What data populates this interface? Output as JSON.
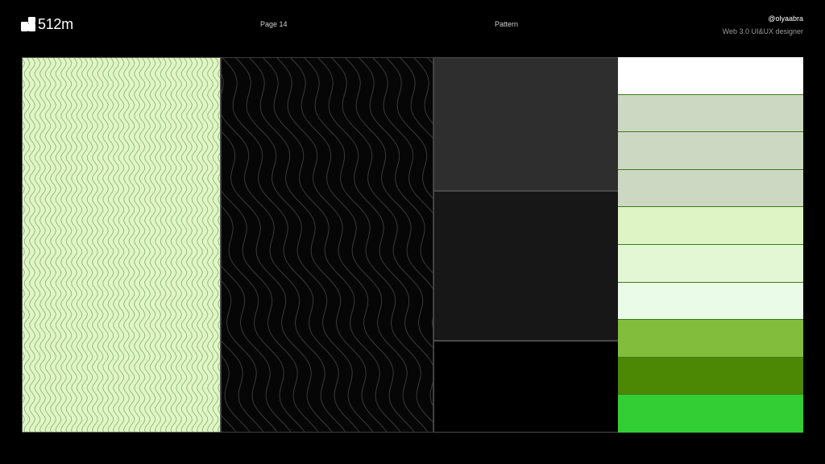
{
  "header": {
    "logo_text": "512m",
    "page_label": "Page 14",
    "section_label": "Pattern",
    "author_handle": "@olyaabra",
    "author_role": "Web 3.0 UI&UX designer"
  },
  "icons": {
    "logo": "stacked-squares-logo-icon"
  },
  "patterns": {
    "light_wave": {
      "background": "#e0f6c4",
      "stroke": "#94ba84"
    },
    "dark_wave": {
      "background": "#060606",
      "stroke": "#3a3a3a"
    }
  },
  "greys": [
    "#2e2e2e",
    "#171717",
    "#000000"
  ],
  "palette": [
    "#ffffff",
    "#cdd8c3",
    "#cdd8c3",
    "#cdd8c3",
    "#def4c5",
    "#e4f7d4",
    "#eafbe8",
    "#82be3b",
    "#4d8804",
    "#33ce33"
  ]
}
